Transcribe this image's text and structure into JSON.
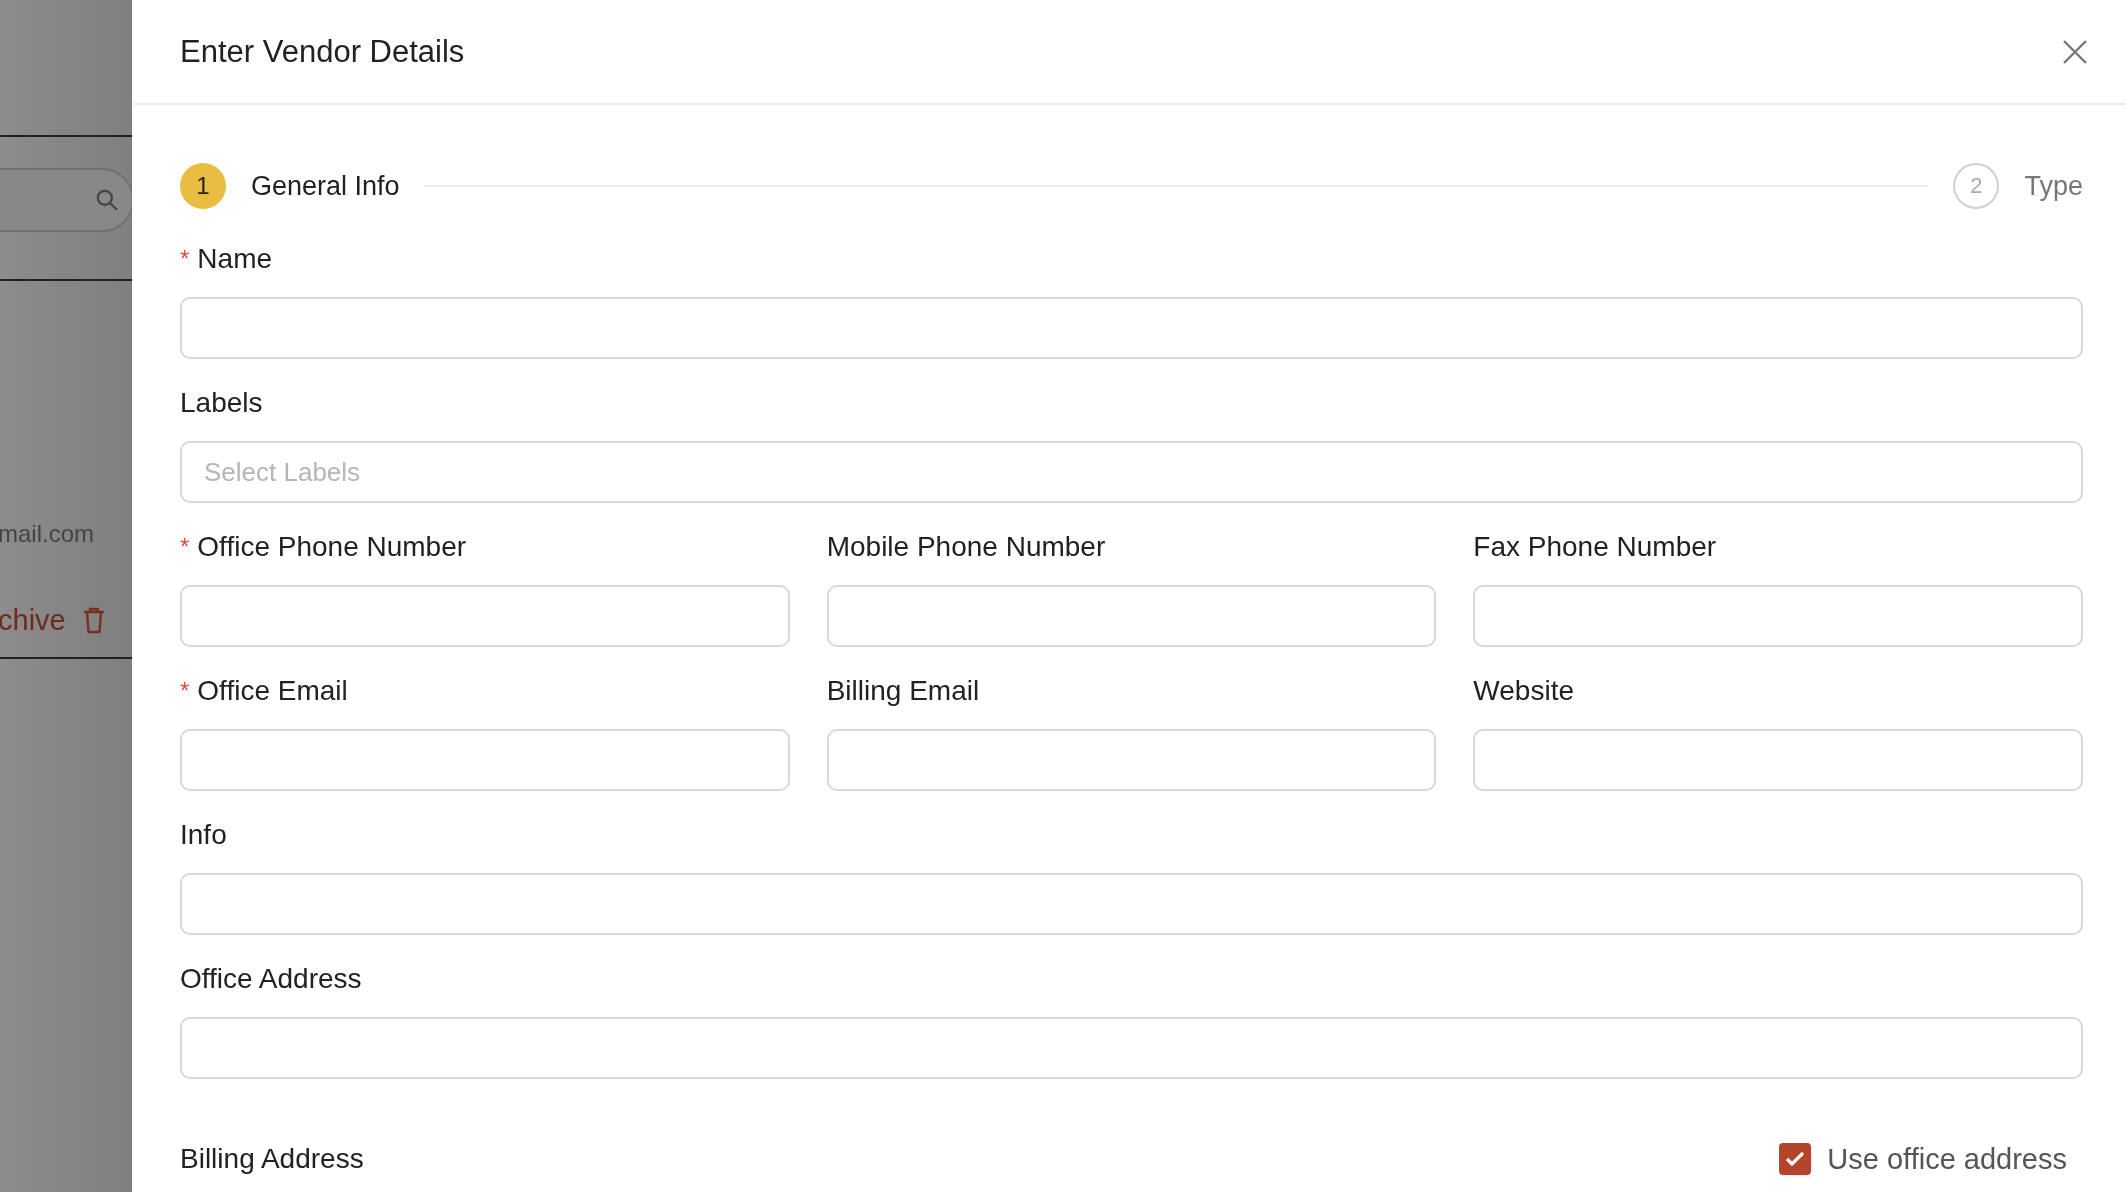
{
  "backdrop": {
    "email_fragment": "mail.com",
    "archive_fragment": "chive"
  },
  "modal": {
    "title": "Enter Vendor Details"
  },
  "required_marker": "*",
  "steps": [
    {
      "number": "1",
      "label": "General Info",
      "selected": true
    },
    {
      "number": "2",
      "label": "Type",
      "selected": false
    }
  ],
  "field_rows": [
    [
      {
        "label": "Name",
        "required": true,
        "kind": "text"
      }
    ],
    [
      {
        "label": "Labels",
        "required": false,
        "kind": "select",
        "placeholder": "Select Labels"
      }
    ],
    [
      {
        "label": "Office Phone Number",
        "required": true,
        "kind": "text"
      },
      {
        "label": "Mobile Phone Number",
        "required": false,
        "kind": "text"
      },
      {
        "label": "Fax Phone Number",
        "required": false,
        "kind": "text"
      }
    ],
    [
      {
        "label": "Office Email",
        "required": true,
        "kind": "text"
      },
      {
        "label": "Billing Email",
        "required": false,
        "kind": "text"
      },
      {
        "label": "Website",
        "required": false,
        "kind": "text"
      }
    ],
    [
      {
        "label": "Info",
        "required": false,
        "kind": "text"
      }
    ],
    [
      {
        "label": "Office Address",
        "required": false,
        "kind": "text"
      }
    ]
  ],
  "billing_address": {
    "label": "Billing Address",
    "checkbox": {
      "label": "Use office address",
      "checked": true
    }
  }
}
